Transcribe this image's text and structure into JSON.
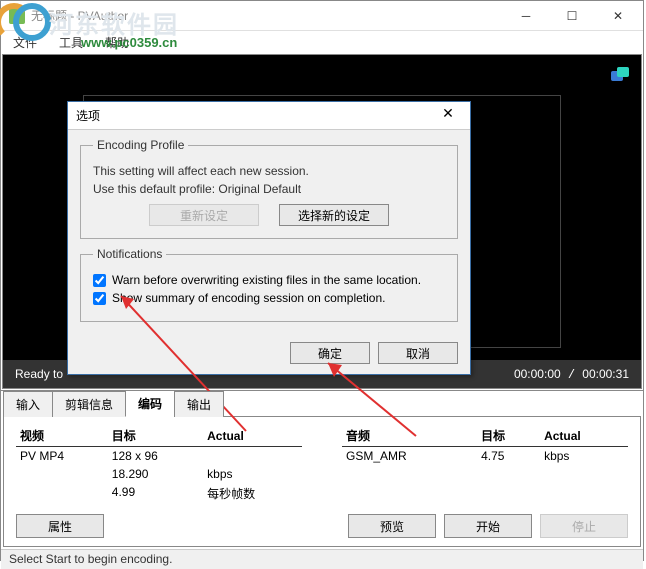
{
  "window": {
    "title": "无标题 - PVAuthor",
    "menu": {
      "file": "文件",
      "tools": "工具",
      "help": "帮助"
    }
  },
  "watermark": {
    "text": "河东软件园",
    "url": "www.pc0359.cn"
  },
  "video": {
    "ready": "Ready to",
    "time_cur": "00:00:00",
    "time_total": "00:00:31"
  },
  "dialog": {
    "title": "选项",
    "encoding_legend": "Encoding Profile",
    "line1": "This setting will affect each new session.",
    "line2": "Use this default profile: Original Default",
    "reset_btn": "重新设定",
    "select_btn": "选择新的设定",
    "notif_legend": "Notifications",
    "chk1": "Warn before overwriting existing files in the same location.",
    "chk2": "Show summary of encoding session on completion.",
    "ok": "确定",
    "cancel": "取消"
  },
  "tabs": {
    "input": "输入",
    "crop": "剪辑信息",
    "encode": "编码",
    "output": "输出"
  },
  "table": {
    "video_h": "视频",
    "target_h": "目标",
    "actual_h": "Actual",
    "audio_h": "音频",
    "v_codec": "PV MP4",
    "v_res": "128 x 96",
    "v_br": "18.290",
    "v_fps": "4.99",
    "v_unit1": "kbps",
    "v_unit2": "每秒帧数",
    "a_codec": "GSM_AMR",
    "a_br": "4.75",
    "a_unit": "kbps"
  },
  "buttons": {
    "props": "属性",
    "preview": "预览",
    "start": "开始",
    "stop": "停止"
  },
  "statusbar": "Select Start to begin encoding."
}
